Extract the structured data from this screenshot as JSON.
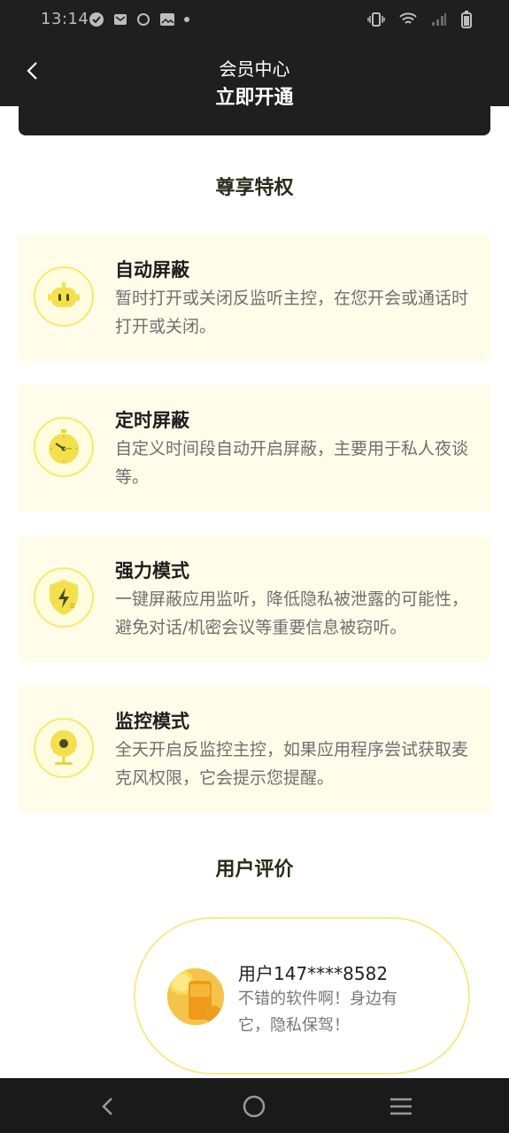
{
  "status_bar": {
    "time": "13:14"
  },
  "header": {
    "title": "会员中心"
  },
  "cta": {
    "label": "立即开通"
  },
  "privileges": {
    "title": "尊享特权",
    "items": [
      {
        "title": "自动屏蔽",
        "desc": "暂时打开或关闭反监听主控，在您开会或通话时打开或关闭。",
        "icon": "robot-icon"
      },
      {
        "title": "定时屏蔽",
        "desc": "自定义时间段自动开启屏蔽，主要用于私人夜谈等。",
        "icon": "timer-icon"
      },
      {
        "title": "强力模式",
        "desc": "一键屏蔽应用监听，降低隐私被泄露的可能性，避免对话/机密会议等重要信息被窃听。",
        "icon": "shield-bolt-icon"
      },
      {
        "title": "监控模式",
        "desc": "全天开启反监控主控，如果应用程序尝试获取麦克风权限，它会提示您提醒。",
        "icon": "webcam-icon"
      }
    ]
  },
  "reviews": {
    "title": "用户评价",
    "items": [
      {
        "user": "用户147****8582",
        "text": "不错的软件啊！身边有它，隐私保驾！"
      }
    ]
  },
  "colors": {
    "accent_yellow": "#f7e96a",
    "card_bg": "#fffce9",
    "dark_bar": "#1f1f1f"
  }
}
